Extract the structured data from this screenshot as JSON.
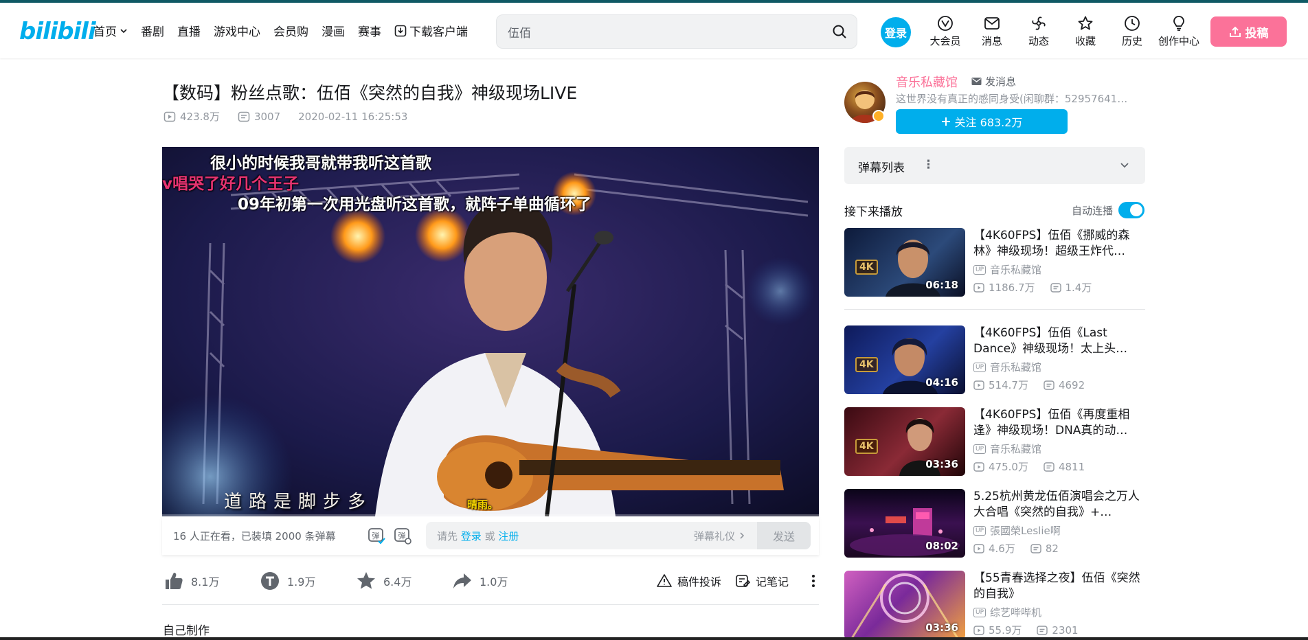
{
  "header": {
    "logo_text": "bilibili",
    "nav": [
      {
        "label": "首页",
        "has_dropdown": true
      },
      {
        "label": "番剧"
      },
      {
        "label": "直播"
      },
      {
        "label": "游戏中心"
      },
      {
        "label": "会员购"
      },
      {
        "label": "漫画"
      },
      {
        "label": "赛事"
      },
      {
        "label": "下载客户端",
        "icon": "download-icon"
      }
    ],
    "search_value": "伍佰",
    "login_label": "登录",
    "icons": [
      {
        "label": "大会员",
        "icon": "vip-icon"
      },
      {
        "label": "消息",
        "icon": "message-icon"
      },
      {
        "label": "动态",
        "icon": "dynamic-icon"
      },
      {
        "label": "收藏",
        "icon": "star-icon"
      },
      {
        "label": "历史",
        "icon": "clock-icon"
      },
      {
        "label": "创作中心",
        "icon": "bulb-icon"
      }
    ],
    "upload_label": "投稿",
    "accent": "#00aeec",
    "pink": "#fb7299"
  },
  "video": {
    "title": "【数码】粉丝点歌：伍佰《突然的自我》神级现场LIVE",
    "views": "423.8万",
    "danmaku_count": "3007",
    "pubdate": "2020-02-11 16:25:53",
    "danmaku": [
      {
        "text": "很小的时候我哥就带我听这首歌",
        "color": "#ffffff"
      },
      {
        "text": "v唱哭了好几个王子",
        "color": "#e63371"
      },
      {
        "text": "09年初第一次用光盘听这首歌，就阵子单曲循环了",
        "color": "#ffffff"
      },
      {
        "text": "晴雨。",
        "color": "#f5d400"
      }
    ],
    "subtitle": "道路是脚步多"
  },
  "danmaku_bar": {
    "watching": "16 人正在看，已装填 2000 条弹幕",
    "placeholder_prefix": "请先",
    "login_link": "登录",
    "or": "或",
    "register_link": "注册",
    "etiquette": "弹幕礼仪",
    "send_label": "发送"
  },
  "toolbar": {
    "like": "8.1万",
    "coin": "1.9万",
    "fav": "6.4万",
    "share": "1.0万",
    "report": "稿件投诉",
    "notes": "记笔记"
  },
  "desc_label": "自己制作",
  "uploader": {
    "name": "音乐私藏馆",
    "message": "发消息",
    "desc": "这世界没有真正的感同身受(闲聊群：52957641…",
    "follow": "关注 683.2万"
  },
  "sidebar": {
    "danmaku_list_label": "弹幕列表",
    "next_label": "接下来播放",
    "autoplay_label": "自动连播"
  },
  "recommendations": [
    {
      "title": "【4K60FPS】伍佰《挪威的森林》神级现场！超级王炸代…",
      "up": "音乐私藏馆",
      "views": "1186.7万",
      "danmaku": "1.4万",
      "duration": "06:18",
      "tag": "4K",
      "thumb_color": "#1d2b52"
    },
    {
      "title": "【4K60FPS】伍佰《Last Dance》神级现场！太上头…",
      "up": "音乐私藏馆",
      "views": "514.7万",
      "danmaku": "4692",
      "duration": "04:16",
      "tag": "4K",
      "thumb_color": "#1a2a6e"
    },
    {
      "title": "【4K60FPS】伍佰《再度重相逢》神级现场！DNA真的动…",
      "up": "音乐私藏馆",
      "views": "475.0万",
      "danmaku": "4811",
      "duration": "03:36",
      "tag": "4K",
      "thumb_color": "#5a1a22"
    },
    {
      "title": "5.25杭州黄龙伍佰演唱会之万人大合唱《突然的自我》+…",
      "up": "張國榮Leslie啊",
      "views": "4.6万",
      "danmaku": "82",
      "duration": "08:02",
      "tag": "",
      "thumb_color": "#2a1040"
    },
    {
      "title": "【55青春选择之夜】伍佰《突然的自我》",
      "up": "综艺哔哔机",
      "views": "55.9万",
      "danmaku": "2301",
      "duration": "03:36",
      "tag": "",
      "thumb_color": "#7a2a8a"
    }
  ]
}
